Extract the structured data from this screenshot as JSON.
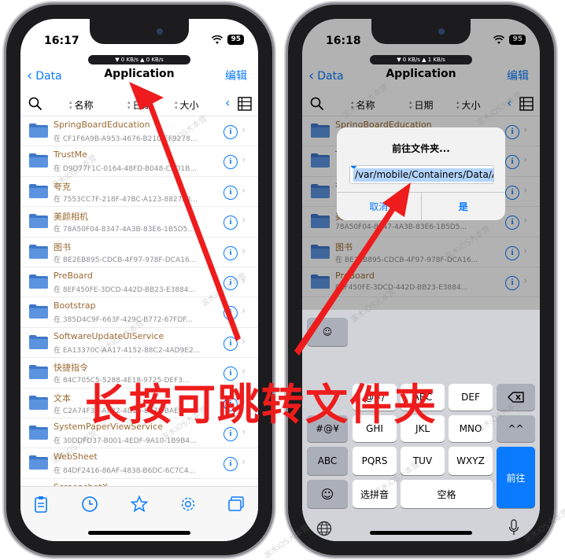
{
  "overlay": {
    "caption": "长按可跳转文件夹",
    "accent": "#ee1c1c"
  },
  "left": {
    "time": "16:17",
    "battery": "95",
    "net": "▼ 0 KB/s   ▲ 0 KB/s",
    "nav": {
      "back": "Data",
      "title": "Application",
      "edit": "编辑"
    },
    "sort": {
      "name": "名称",
      "date": "日期",
      "size": "大小"
    },
    "rows": [
      {
        "name": "SpringBoardEducation",
        "sub": "在 CF1F6A9B-A953-4676-B210-EF9278..."
      },
      {
        "name": "TrustMe",
        "sub": "在 D9D77F1C-0164-48FD-B048-CED1B..."
      },
      {
        "name": "夸克",
        "sub": "在 7553CC7F-218F-47BC-A123-8827F0..."
      },
      {
        "name": "美颜相机",
        "sub": "在 78A50F04-8347-4A3B-83E6-1B5D5..."
      },
      {
        "name": "图书",
        "sub": "在 BE2EB895-CDCB-4F97-978F-DCA16..."
      },
      {
        "name": "PreBoard",
        "sub": "在 8EF450FE-3DCD-442D-BB23-E3884..."
      },
      {
        "name": "Bootstrap",
        "sub": "在 385D4C9F-663F-429C-B772-67FDF..."
      },
      {
        "name": "SoftwareUpdateUIService",
        "sub": "在 EA13370C-AA17-4152-88C2-4AD9E2..."
      },
      {
        "name": "快捷指令",
        "sub": "在 84C705C5-5288-4E18-9725-DEF3..."
      },
      {
        "name": "文本",
        "sub": "在 C2A74F3A-A922-4D25-B77F-BAE9..."
      },
      {
        "name": "SystemPaperViewService",
        "sub": "在 30DDFD37-B001-4EDF-9A10-1B9B4..."
      },
      {
        "name": "WebSheet",
        "sub": "在 84DF2416-86AF-4838-B6DC-6C7C4..."
      },
      {
        "name": "ScreenshotX",
        "sub": ""
      }
    ]
  },
  "right": {
    "time": "16:18",
    "battery": "95",
    "net": "▼ 0 KB/s   ▲ 1 KB/s",
    "nav": {
      "back": "Data",
      "title": "Application",
      "edit": "编辑"
    },
    "sort": {
      "name": "名称",
      "date": "日期",
      "size": "大小"
    },
    "rows": [
      {
        "name": "SpringBoardEducation",
        "sub": ""
      },
      {
        "name": "T",
        "sub": ""
      },
      {
        "name": "夸",
        "sub": ""
      },
      {
        "name": "美",
        "sub": "78A50F04-8347-4A3B-83E6-1B5D5..."
      },
      {
        "name": "图书",
        "sub": "在 BE2EB895-CDCB-4F97-978F-DCA16..."
      },
      {
        "name": "PreBoard",
        "sub": "8EF450FE-3DCD-442D-BB23-E3884..."
      }
    ],
    "dialog": {
      "title": "前往文件夹...",
      "value": "/var/mobile/Containers/Data/A",
      "cancel": "取消",
      "ok": "是"
    },
    "keyboard": {
      "row1": [
        "@#/",
        "ABC",
        "DEF"
      ],
      "row2": [
        "#@¥",
        "GHI",
        "JKL",
        "MNO",
        "^^"
      ],
      "row3": [
        "ABC",
        "PQRS",
        "TUV",
        "WXYZ"
      ],
      "row4": [
        "选拼音",
        "空格"
      ],
      "go": "前往"
    }
  },
  "watermark": "滚木iOS大本营"
}
